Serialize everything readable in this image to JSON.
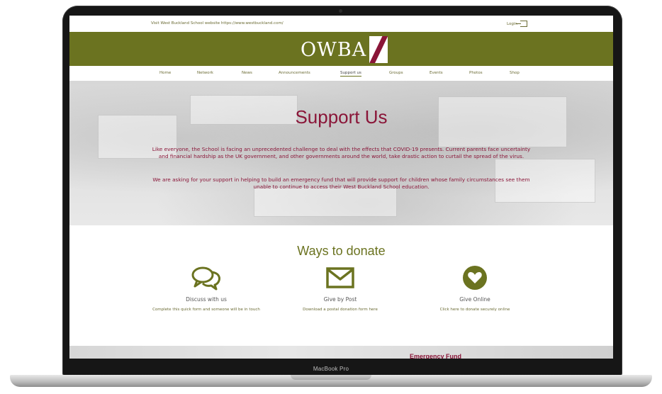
{
  "device": {
    "label": "MacBook Pro"
  },
  "topbar": {
    "visit_text": "Visit West Buckland School website https://www.westbuckland.com/",
    "login_label": "Login"
  },
  "banner": {
    "logo_text": "OWBA"
  },
  "nav": {
    "items": [
      "Home",
      "Network",
      "News",
      "Announcements",
      "Support us",
      "Groups",
      "Events",
      "Photos",
      "Shop"
    ],
    "active": "Support us"
  },
  "hero": {
    "title": "Support Us",
    "paragraph1": "Like everyone, the School is facing an unprecedented challenge to deal with the effects that COVID-19 presents. Current parents face uncertainty and financial hardship as the UK government, and other governments around the world, take drastic action to curtail the spread of the virus.",
    "paragraph2": "We are asking for your support in helping to build an emergency fund that will provide support for children whose family circumstances see them unable to continue to access their West Buckland School education."
  },
  "donate": {
    "title": "Ways to donate",
    "options": [
      {
        "icon": "chat-bubbles-icon",
        "heading": "Discuss with us",
        "desc": "Complete this quick form and someone will be in touch"
      },
      {
        "icon": "envelope-icon",
        "heading": "Give by Post",
        "desc": "Download a postal donation form here"
      },
      {
        "icon": "heart-circle-icon",
        "heading": "Give Online",
        "desc": "Click here to donate securely online"
      }
    ]
  },
  "footer_preview": {
    "heading": "Emergency Fund"
  },
  "colors": {
    "olive": "#6b7320",
    "maroon": "#8a1538"
  }
}
